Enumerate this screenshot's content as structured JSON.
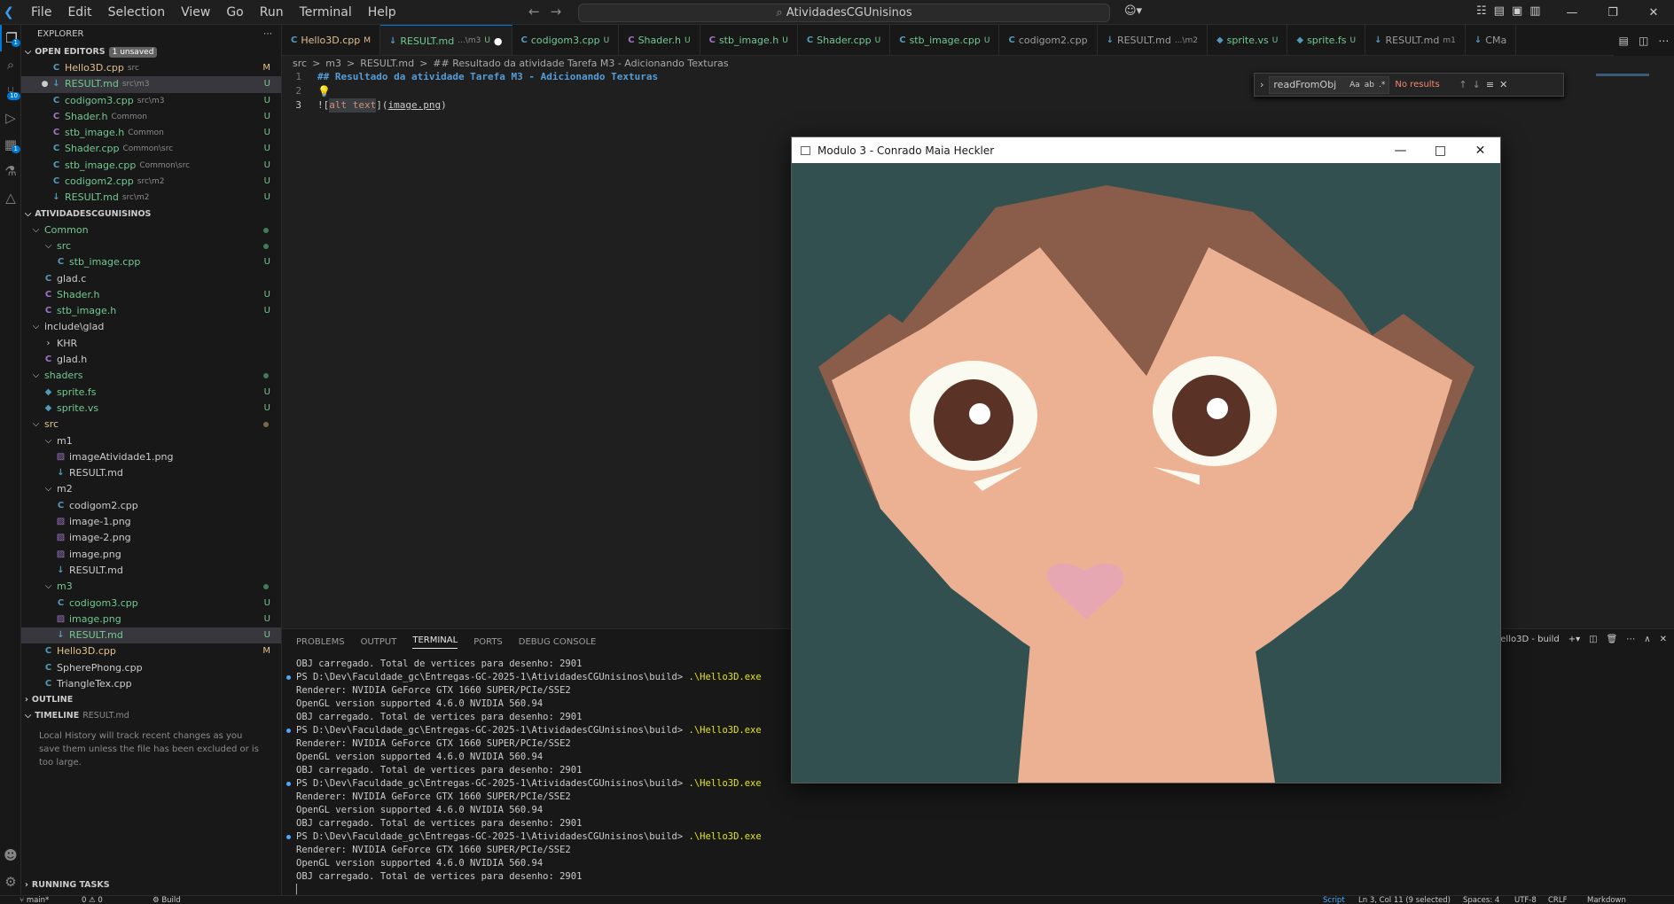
{
  "menu": [
    "File",
    "Edit",
    "Selection",
    "View",
    "Go",
    "Run",
    "Terminal",
    "Help"
  ],
  "search_box": "AtividadesCGUnisinos",
  "explorer": {
    "title": "EXPLORER",
    "open_editors_label": "OPEN EDITORS",
    "unsaved_badge": "1 unsaved",
    "open_editors": [
      {
        "name": "Hello3D.cpp",
        "sub": "src",
        "status": "M",
        "type": "cpp"
      },
      {
        "name": "RESULT.md",
        "sub": "src\\m3",
        "status": "U",
        "type": "md",
        "selected": true,
        "dirty": true
      },
      {
        "name": "codigom3.cpp",
        "sub": "src\\m3",
        "status": "U",
        "type": "cpp"
      },
      {
        "name": "Shader.h",
        "sub": "Common",
        "status": "U",
        "type": "h"
      },
      {
        "name": "stb_image.h",
        "sub": "Common",
        "status": "U",
        "type": "h"
      },
      {
        "name": "Shader.cpp",
        "sub": "Common\\src",
        "status": "U",
        "type": "cpp"
      },
      {
        "name": "stb_image.cpp",
        "sub": "Common\\src",
        "status": "U",
        "type": "cpp"
      },
      {
        "name": "codigom2.cpp",
        "sub": "src\\m2",
        "status": "U",
        "type": "cpp"
      },
      {
        "name": "RESULT.md",
        "sub": "src\\m2",
        "status": "U",
        "type": "md"
      }
    ],
    "workspace_label": "ATIVIDADESCGUNISINOS",
    "tree": [
      {
        "name": "Common",
        "depth": 0,
        "folder": true
      },
      {
        "name": "src",
        "depth": 1,
        "folder": true
      },
      {
        "name": "stb_image.cpp",
        "depth": 2,
        "status": "U",
        "type": "cpp"
      },
      {
        "name": "glad.c",
        "depth": 1,
        "type": "c"
      },
      {
        "name": "Shader.h",
        "depth": 1,
        "status": "U",
        "type": "h"
      },
      {
        "name": "stb_image.h",
        "depth": 1,
        "status": "U",
        "type": "h"
      },
      {
        "name": "include\\glad",
        "depth": 0,
        "folder": true
      },
      {
        "name": "KHR",
        "depth": 1,
        "folder": true,
        "collapsed": true
      },
      {
        "name": "glad.h",
        "depth": 1,
        "type": "h"
      },
      {
        "name": "shaders",
        "depth": 0,
        "folder": true
      },
      {
        "name": "sprite.fs",
        "depth": 1,
        "status": "U",
        "type": "fs"
      },
      {
        "name": "sprite.vs",
        "depth": 1,
        "status": "U",
        "type": "fs"
      },
      {
        "name": "src",
        "depth": 0,
        "folder": true
      },
      {
        "name": "m1",
        "depth": 1,
        "folder": true
      },
      {
        "name": "imageAtividade1.png",
        "depth": 2,
        "type": "png"
      },
      {
        "name": "RESULT.md",
        "depth": 2,
        "type": "md"
      },
      {
        "name": "m2",
        "depth": 1,
        "folder": true
      },
      {
        "name": "codigom2.cpp",
        "depth": 2,
        "type": "cpp"
      },
      {
        "name": "image-1.png",
        "depth": 2,
        "type": "png"
      },
      {
        "name": "image-2.png",
        "depth": 2,
        "type": "png"
      },
      {
        "name": "image.png",
        "depth": 2,
        "type": "png"
      },
      {
        "name": "RESULT.md",
        "depth": 2,
        "type": "md"
      },
      {
        "name": "m3",
        "depth": 1,
        "folder": true
      },
      {
        "name": "codigom3.cpp",
        "depth": 2,
        "status": "U",
        "type": "cpp"
      },
      {
        "name": "image.png",
        "depth": 2,
        "status": "U",
        "type": "png"
      },
      {
        "name": "RESULT.md",
        "depth": 2,
        "status": "U",
        "type": "md",
        "selected": true
      },
      {
        "name": "Hello3D.cpp",
        "depth": 1,
        "status": "M",
        "type": "cpp"
      },
      {
        "name": "SpherePhong.cpp",
        "depth": 1,
        "type": "cpp"
      },
      {
        "name": "TriangleTex.cpp",
        "depth": 1,
        "type": "cpp"
      }
    ],
    "outline_label": "OUTLINE",
    "timeline_label": "TIMELINE",
    "timeline_file": "RESULT.md",
    "timeline_text": "Local History will track recent changes as you save them unless the file has been excluded or is too large.",
    "running_tasks_label": "RUNNING TASKS"
  },
  "tabs": [
    {
      "name": "Hello3D.cpp",
      "status": "M",
      "type": "cpp"
    },
    {
      "name": "RESULT.md",
      "sub": "...\\m3",
      "status": "U",
      "type": "md",
      "active": true,
      "dirty": true
    },
    {
      "name": "codigom3.cpp",
      "status": "U",
      "type": "cpp"
    },
    {
      "name": "Shader.h",
      "status": "U",
      "type": "h"
    },
    {
      "name": "stb_image.h",
      "status": "U",
      "type": "h"
    },
    {
      "name": "Shader.cpp",
      "status": "U",
      "type": "cpp"
    },
    {
      "name": "stb_image.cpp",
      "status": "U",
      "type": "cpp"
    },
    {
      "name": "codigom2.cpp",
      "type": "cpp"
    },
    {
      "name": "RESULT.md",
      "sub": "...\\m2",
      "type": "md"
    },
    {
      "name": "sprite.vs",
      "status": "U",
      "type": "fs"
    },
    {
      "name": "sprite.fs",
      "status": "U",
      "type": "fs"
    },
    {
      "name": "RESULT.md",
      "sub": "m1",
      "type": "md"
    },
    {
      "name": "CMa",
      "type": "md"
    }
  ],
  "breadcrumbs": [
    "src",
    ">",
    "m3",
    ">",
    "RESULT.md",
    ">",
    "## Resultado da atividade Tarefa M3 - Adicionando Texturas"
  ],
  "editor": {
    "lines": [
      {
        "num": "1",
        "text": "## Resultado da atividade Tarefa M3 - Adicionando Texturas"
      },
      {
        "num": "2",
        "text": ""
      },
      {
        "num": "3",
        "alt": "alt text",
        "path": "image.png"
      }
    ]
  },
  "find": {
    "value": "readFromObj",
    "opt1": "Aa",
    "opt2": "ab",
    "opt3": ".*",
    "result": "No results"
  },
  "panel": {
    "tabs": [
      "PROBLEMS",
      "OUTPUT",
      "TERMINAL",
      "PORTS",
      "DEBUG CONSOLE"
    ],
    "active_tab": "TERMINAL",
    "terminal_name": "Hello3D - build",
    "lines": [
      {
        "text": "OBJ carregado. Total de vertices para desenho: 2901"
      },
      {
        "prompt": "PS D:\\Dev\\Faculdade_gc\\Entregas-GC-2025-1\\AtividadesCGUnisinos\\build> ",
        "cmd": ".\\Hello3D.exe",
        "bullet": true
      },
      {
        "text": "Renderer: NVIDIA GeForce GTX 1660 SUPER/PCIe/SSE2"
      },
      {
        "text": "OpenGL version supported 4.6.0 NVIDIA 560.94"
      },
      {
        "text": "OBJ carregado. Total de vertices para desenho: 2901"
      },
      {
        "prompt": "PS D:\\Dev\\Faculdade_gc\\Entregas-GC-2025-1\\AtividadesCGUnisinos\\build> ",
        "cmd": ".\\Hello3D.exe",
        "bullet": true
      },
      {
        "text": "Renderer: NVIDIA GeForce GTX 1660 SUPER/PCIe/SSE2"
      },
      {
        "text": "OpenGL version supported 4.6.0 NVIDIA 560.94"
      },
      {
        "text": "OBJ carregado. Total de vertices para desenho: 2901"
      },
      {
        "prompt": "PS D:\\Dev\\Faculdade_gc\\Entregas-GC-2025-1\\AtividadesCGUnisinos\\build> ",
        "cmd": ".\\Hello3D.exe",
        "bullet": true
      },
      {
        "text": "Renderer: NVIDIA GeForce GTX 1660 SUPER/PCIe/SSE2"
      },
      {
        "text": "OpenGL version supported 4.6.0 NVIDIA 560.94"
      },
      {
        "text": "OBJ carregado. Total de vertices para desenho: 2901"
      },
      {
        "prompt": "PS D:\\Dev\\Faculdade_gc\\Entregas-GC-2025-1\\AtividadesCGUnisinos\\build> ",
        "cmd": ".\\Hello3D.exe",
        "bullet": true
      },
      {
        "text": "Renderer: NVIDIA GeForce GTX 1660 SUPER/PCIe/SSE2"
      },
      {
        "text": "OpenGL version supported 4.6.0 NVIDIA 560.94"
      },
      {
        "text": "OBJ carregado. Total de vertices para desenho: 2901"
      }
    ]
  },
  "app_window": {
    "title": "Modulo 3 - Conrado Maia Heckler"
  },
  "status": {
    "branch": "main*",
    "problems": "0 ⚠ 0",
    "build": "Build",
    "script": "Script",
    "position": "Ln 3, Col 11 (9 selected)",
    "spaces": "Spaces: 4",
    "encoding": "UTF-8",
    "eol": "CRLF",
    "language": "Markdown"
  },
  "colors": {
    "accent": "#0078d4",
    "modified": "#e2c08d",
    "untracked": "#73c991",
    "scene_bg": "#325050",
    "skin": "#ecb192",
    "fur": "#8a5c4a"
  }
}
